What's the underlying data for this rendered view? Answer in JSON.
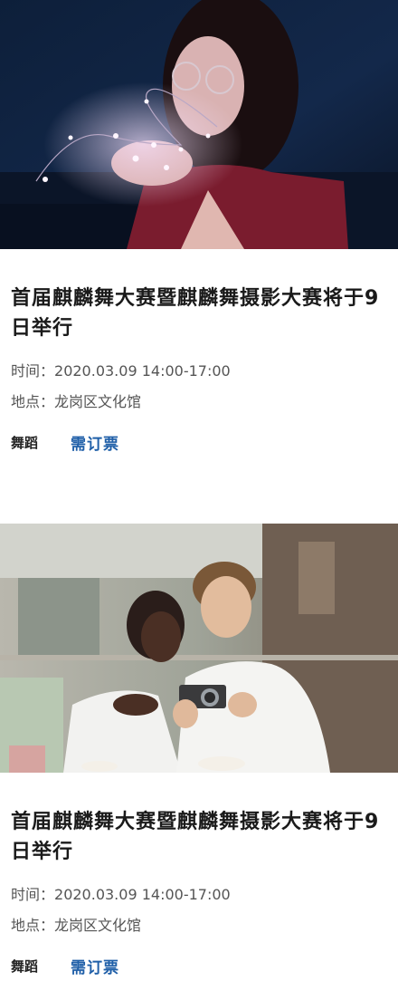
{
  "events": [
    {
      "image_alt": "woman holding string lights",
      "title": "首届麒麟舞大赛暨麒麟舞摄影大赛将于9日举行",
      "time_label": "时间：",
      "time_value": "2020.03.09 14:00-17:00",
      "place_label": "地点：",
      "place_value": "龙岗区文化馆",
      "category": "舞蹈",
      "booking": "需订票"
    },
    {
      "image_alt": "two people looking at a camera",
      "title": "首届麒麟舞大赛暨麒麟舞摄影大赛将于9日举行",
      "time_label": "时间：",
      "time_value": "2020.03.09 14:00-17:00",
      "place_label": "地点：",
      "place_value": "龙岗区文化馆",
      "category": "舞蹈",
      "booking": "需订票"
    }
  ]
}
